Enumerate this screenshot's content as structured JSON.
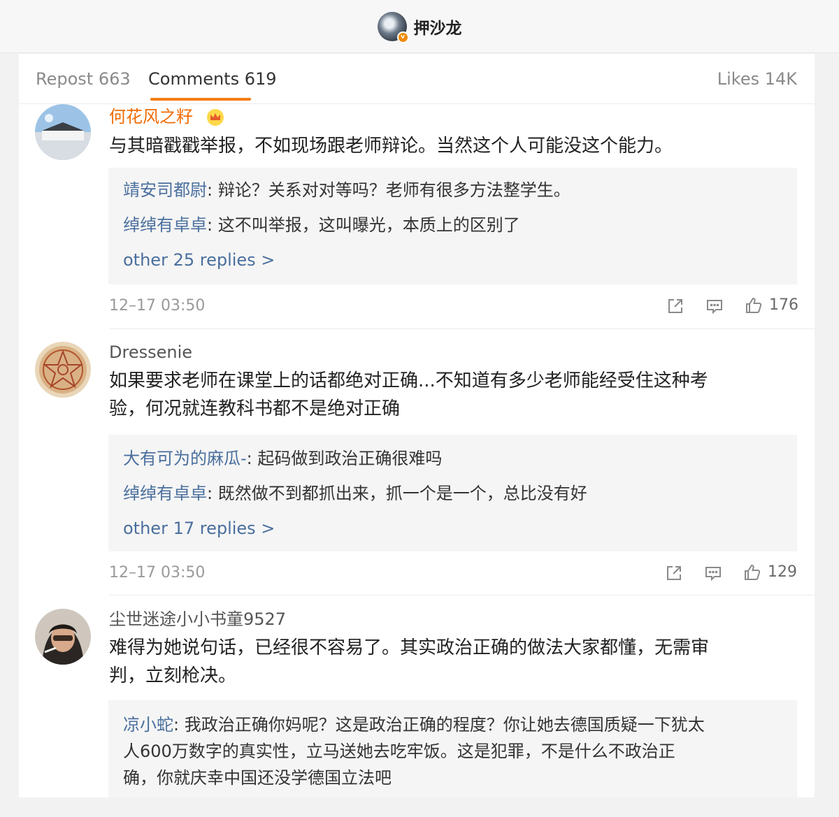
{
  "header": {
    "title": "押沙龙",
    "verified_badge": "v"
  },
  "tabs": {
    "repost": "Repost 663",
    "comments": "Comments 619",
    "likes": "Likes 14K"
  },
  "comments": [
    {
      "name": "何花风之籽",
      "name_color": "#f06b05",
      "has_crown": true,
      "text": "与其暗戳戳举报，不如现场跟老师辩论。当然这个人可能没这个能力。",
      "replies": [
        {
          "name": "靖安司都尉",
          "text": ": 辩论？关系对对等吗？老师有很多方法整学生。"
        },
        {
          "name": "绰绰有卓卓",
          "text": ": 这不叫举报，这叫曝光，本质上的区别了"
        }
      ],
      "more": "other 25 replies >",
      "time": "12–17 03:50",
      "likes": "176"
    },
    {
      "name": "Dressenie",
      "name_color": "#555555",
      "has_crown": false,
      "text_lines": [
        "如果要求老师在课堂上的话都绝对正确...不知道有多少老师能经受住这种考",
        "验，何况就连教科书都不是绝对正确"
      ],
      "replies": [
        {
          "name": "大有可为的麻瓜-",
          "text": ": 起码做到政治正确很难吗"
        },
        {
          "name": "绰绰有卓卓",
          "text": ": 既然做不到都抓出来，抓一个是一个，总比没有好"
        }
      ],
      "more": "other 17 replies >",
      "time": "12–17 03:50",
      "likes": "129"
    },
    {
      "name": "尘世迷途小小书童9527",
      "name_color": "#555555",
      "has_crown": false,
      "text_lines": [
        "难得为她说句话，已经很不容易了。其实政治正确的做法大家都懂，无需审",
        "判，立刻枪决。"
      ],
      "replies": [
        {
          "name": "凉小蛇",
          "text_lines": [
            ": 我政治正确你妈呢？这是政治正确的程度？你让她去德国质疑一下犹太",
            "人600万数字的真实性，立马送她去吃牢饭。这是犯罪，不是什么不政治正",
            "确，你就庆幸中国还没学德国立法吧"
          ]
        }
      ]
    }
  ],
  "colors": {
    "accent": "#f47c13",
    "link": "#4a6f9d"
  }
}
